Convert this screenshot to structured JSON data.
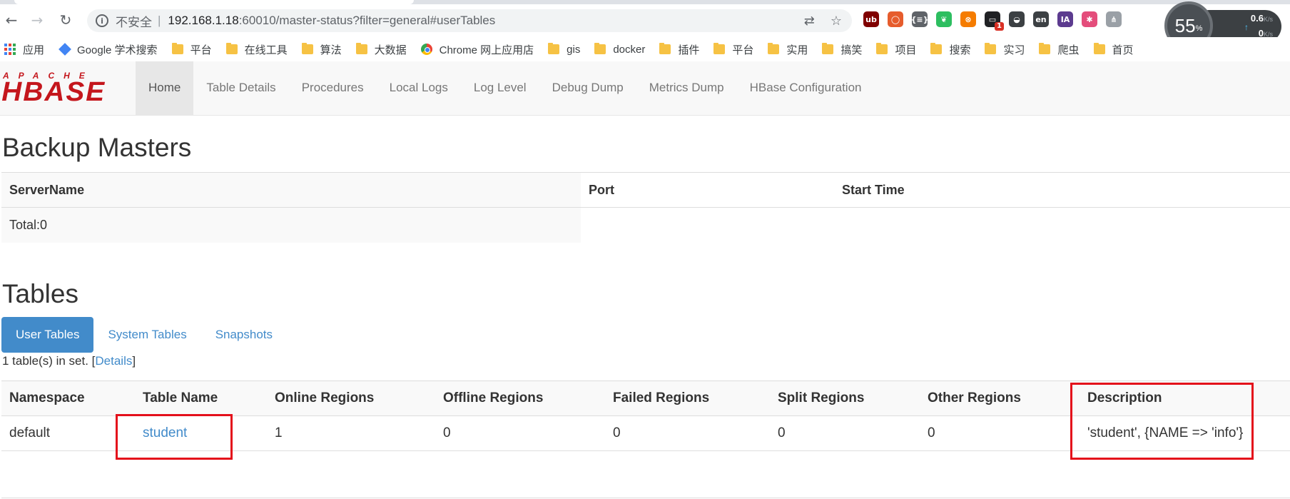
{
  "browser": {
    "back_glyph": "←",
    "forward_glyph": "→",
    "reload_glyph": "↻",
    "info_glyph": "i",
    "insecure_label": "不安全",
    "separator": "|",
    "url_host": "192.168.1.18",
    "url_rest": ":60010/master-status?filter=general#userTables",
    "translate_glyph": "⇄",
    "bookmark_star_glyph": "☆",
    "extensions": [
      {
        "name": "ublock-icon",
        "text": "ub",
        "color": "#800000",
        "badge": ""
      },
      {
        "name": "ring-extension-icon",
        "text": "◯",
        "color": "#e65c2c",
        "badge": ""
      },
      {
        "name": "json-viewer-icon",
        "text": "{≡}",
        "color": "#5f6368",
        "badge": ""
      },
      {
        "name": "evernote-icon",
        "text": "❦",
        "color": "#2dbe60",
        "badge": ""
      },
      {
        "name": "lifebuoy-icon",
        "text": "⊗",
        "color": "#f57c00",
        "badge": ""
      },
      {
        "name": "messenger-icon",
        "text": "▭",
        "color": "#202124",
        "badge": "1"
      },
      {
        "name": "mask-icon",
        "text": "◒",
        "color": "#3c4043",
        "badge": ""
      },
      {
        "name": "translate-extension-icon",
        "text": "en",
        "color": "#3c4043",
        "badge": ""
      },
      {
        "name": "ia-icon",
        "text": "IA",
        "color": "#5c3b8f",
        "badge": ""
      },
      {
        "name": "asterisk-icon",
        "text": "✱",
        "color": "#e44d7b",
        "badge": ""
      },
      {
        "name": "sitemap-icon",
        "text": "⋔",
        "color": "#9aa0a6",
        "badge": ""
      }
    ],
    "speed": {
      "percent": "55",
      "percent_unit": "%",
      "up_value": "0.6",
      "up_unit": "K/s",
      "down_value": "0",
      "down_unit": "K/s",
      "up_glyph": "↑",
      "down_glyph": "↓"
    },
    "bookmarks": [
      {
        "label": "应用",
        "kind": "apps"
      },
      {
        "label": "Google 学术搜索",
        "kind": "google"
      },
      {
        "label": "平台",
        "kind": "folder"
      },
      {
        "label": "在线工具",
        "kind": "folder"
      },
      {
        "label": "算法",
        "kind": "folder"
      },
      {
        "label": "大数据",
        "kind": "folder"
      },
      {
        "label": "Chrome 网上应用店",
        "kind": "chrome"
      },
      {
        "label": "gis",
        "kind": "folder"
      },
      {
        "label": "docker",
        "kind": "folder"
      },
      {
        "label": "插件",
        "kind": "folder"
      },
      {
        "label": "平台",
        "kind": "folder"
      },
      {
        "label": "实用",
        "kind": "folder"
      },
      {
        "label": "搞笑",
        "kind": "folder"
      },
      {
        "label": "项目",
        "kind": "folder"
      },
      {
        "label": "搜索",
        "kind": "folder"
      },
      {
        "label": "实习",
        "kind": "folder"
      },
      {
        "label": "爬虫",
        "kind": "folder"
      },
      {
        "label": "首页",
        "kind": "folder"
      }
    ]
  },
  "hbase": {
    "logo_top": "APACHE",
    "logo_main": "HBASE",
    "nav": [
      "Home",
      "Table Details",
      "Procedures",
      "Local Logs",
      "Log Level",
      "Debug Dump",
      "Metrics Dump",
      "HBase Configuration"
    ],
    "backup_masters": {
      "title": "Backup Masters",
      "headers": [
        "ServerName",
        "Port",
        "Start Time"
      ],
      "total": "Total:0"
    },
    "tables": {
      "title": "Tables",
      "tabs": [
        "User Tables",
        "System Tables",
        "Snapshots"
      ],
      "summary_prefix": "1 table(s) in set. [",
      "summary_link": "Details",
      "summary_suffix": "]",
      "headers": [
        "Namespace",
        "Table Name",
        "Online Regions",
        "Offline Regions",
        "Failed Regions",
        "Split Regions",
        "Other Regions",
        "Description"
      ],
      "rows": [
        [
          "default",
          "student",
          "1",
          "0",
          "0",
          "0",
          "0",
          "'student', {NAME => 'info'}"
        ]
      ]
    },
    "highlight_color": "#e4101b"
  }
}
